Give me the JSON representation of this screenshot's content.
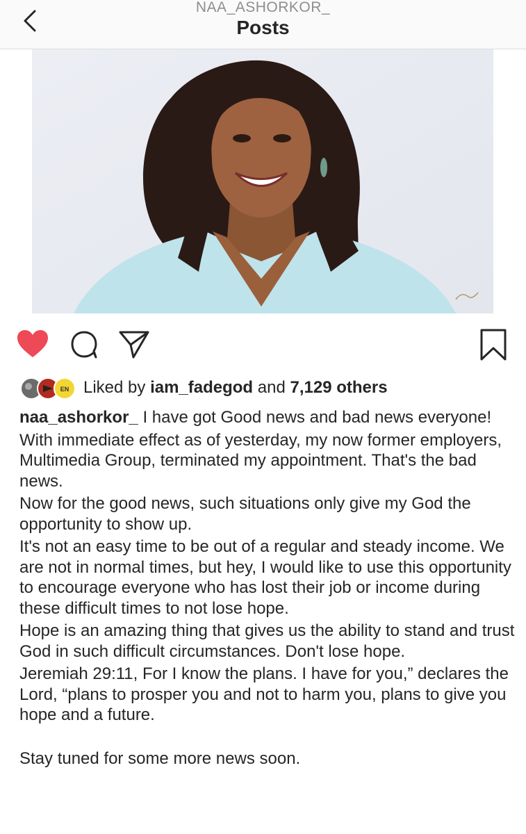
{
  "header": {
    "username": "NAA_ASHORKOR_",
    "title": "Posts",
    "back_icon": "chevron-left-icon"
  },
  "post": {
    "photo_alt": "profile photo",
    "actions": {
      "like_icon": "heart-filled-icon",
      "comment_icon": "comment-icon",
      "share_icon": "send-icon",
      "save_icon": "bookmark-icon",
      "like_color": "#ed4956"
    },
    "likes": {
      "prefix": "Liked by",
      "user": "iam_fadegod",
      "middle": "and",
      "count": "7,129 others"
    },
    "caption": {
      "username": "naa_ashorkor_",
      "lines": [
        "I have got Good news and bad news everyone!",
        "With immediate effect as of yesterday, my now former employers, Multimedia Group, terminated my appointment. That's the bad news.",
        "Now for the good news, such situations only give my God the opportunity to show up.",
        "It's not an easy time to be out  of a regular and steady income. We are not in normal times, but hey, I would like to use this opportunity to encourage everyone who has lost their job or income during these difficult times to  not lose hope.",
        "Hope is an amazing thing that gives us the ability to stand and trust God in such difficult circumstances. Don't lose hope.",
        "Jeremiah 29:11, For I know the plans. I have for you,” declares the Lord, “plans to prosper you and not to harm you, plans to give you hope and a future.",
        "Stay tuned for some more news soon."
      ]
    }
  }
}
